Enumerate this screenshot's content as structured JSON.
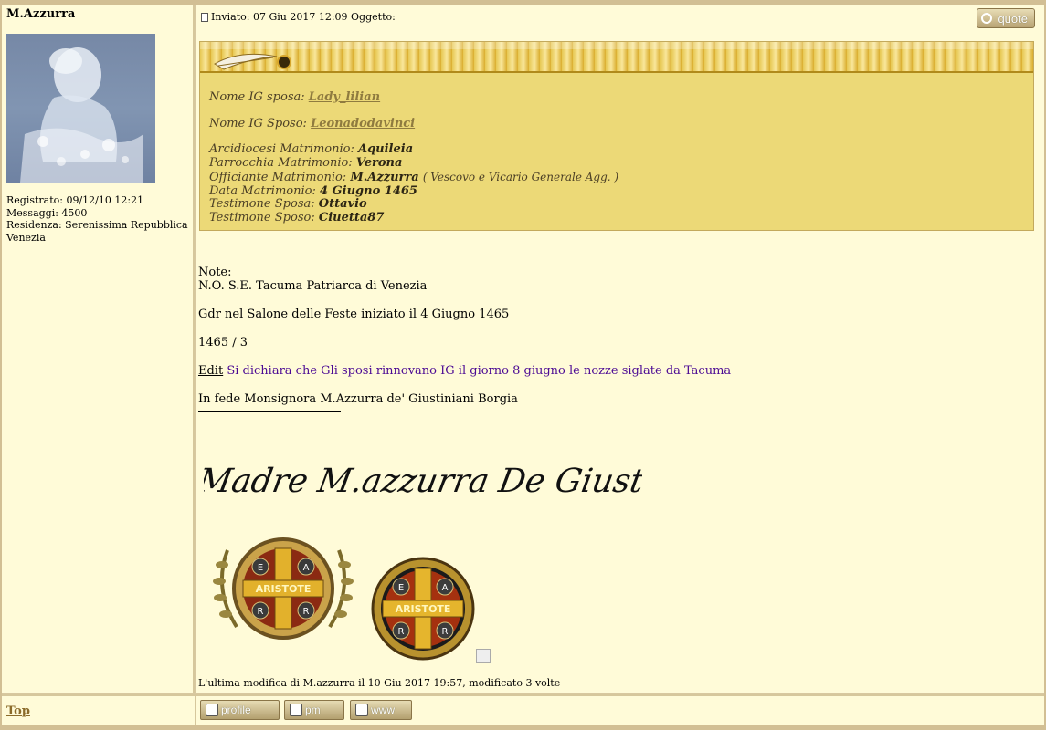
{
  "user": {
    "name": "M.Azzurra",
    "info": [
      "Registrato: 09/12/10 12:21",
      "Messaggi: 4500",
      "Residenza: Serenissima Repubblica Venezia"
    ]
  },
  "post": {
    "header": "Inviato: 07 Giu 2017 12:09 Oggetto:",
    "quote_label": "quote",
    "ig": {
      "sposa_label": "Nome IG sposa:",
      "sposa": "Lady_lilian",
      "sposo_label": "Nome IG Sposo:",
      "sposo": "Leonadodavinci",
      "fields": [
        {
          "label": "Arcidiocesi Matrimonio:",
          "value": "Aquileia",
          "extra": ""
        },
        {
          "label": "Parrocchia Matrimonio:",
          "value": "Verona",
          "extra": ""
        },
        {
          "label": "Officiante Matrimonio:",
          "value": "M.Azzurra",
          "extra": "( Vescovo e Vicario Generale Agg. )"
        },
        {
          "label": "Data Matrimonio:",
          "value": "4 Giugno 1465",
          "extra": ""
        },
        {
          "label": "Testimone Sposa:",
          "value": "Ottavio",
          "extra": ""
        },
        {
          "label": "Testimone Sposo:",
          "value": "Ciuetta87",
          "extra": ""
        }
      ]
    },
    "notes": {
      "title": "Note:",
      "line1": "N.O. S.E. Tacuma Patriarca di Venezia",
      "line2": "Gdr nel Salone delle Feste iniziato il 4 Giugno 1465",
      "line3": "1465 / 3",
      "edit_label": "Edit",
      "edit_text": "Si dichiara che Gli sposi rinnovano IG il giorno 8 giugno le nozze siglate da Tacuma",
      "fede": "In fede Monsignora M.Azzurra de' Giustiniani Borgia"
    },
    "signature": "Madre M.azzurra De Giustiniani De Curtis",
    "medal_text": "ARISTOTE",
    "medal_letters": [
      "E",
      "A",
      "R",
      "R"
    ],
    "last_modified": "L'ultima modifica di M.azzurra il 10 Giu 2017 19:57, modificato 3 volte"
  },
  "footer": {
    "top_link": "Top",
    "buttons": {
      "profile": "profile",
      "pm": "pm",
      "www": "www"
    }
  },
  "colors": {
    "background": "#fffbd8",
    "border": "#d2bf94",
    "ig_box": "#ecd977",
    "edit_purple": "#4b0a94"
  }
}
